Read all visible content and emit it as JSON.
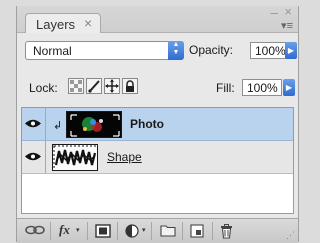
{
  "panel": {
    "tab_label": "Layers",
    "tab_close_glyph": "×",
    "minimize_glyph": "‒",
    "close_glyph": "×",
    "menu_glyph": "▾≡"
  },
  "blend": {
    "mode": "Normal",
    "opacity_label": "Opacity:",
    "opacity_value": "100%"
  },
  "lock": {
    "label": "Lock:",
    "icons": [
      "lock-transparent-icon",
      "lock-paint-icon",
      "lock-position-icon",
      "lock-all-icon"
    ]
  },
  "fill": {
    "label": "Fill:",
    "value": "100%"
  },
  "layers": [
    {
      "name": "Photo",
      "selected": true,
      "visible": true,
      "clipped": true,
      "thumbnail": "photo-thumbnail"
    },
    {
      "name": "Shape",
      "selected": false,
      "visible": true,
      "clipped": false,
      "thumbnail": "shape-thumbnail"
    }
  ],
  "bottom": {
    "fx_label": "fx"
  },
  "colors": {
    "selection": "#b9d3ee",
    "accent": "#2f6bd0"
  }
}
